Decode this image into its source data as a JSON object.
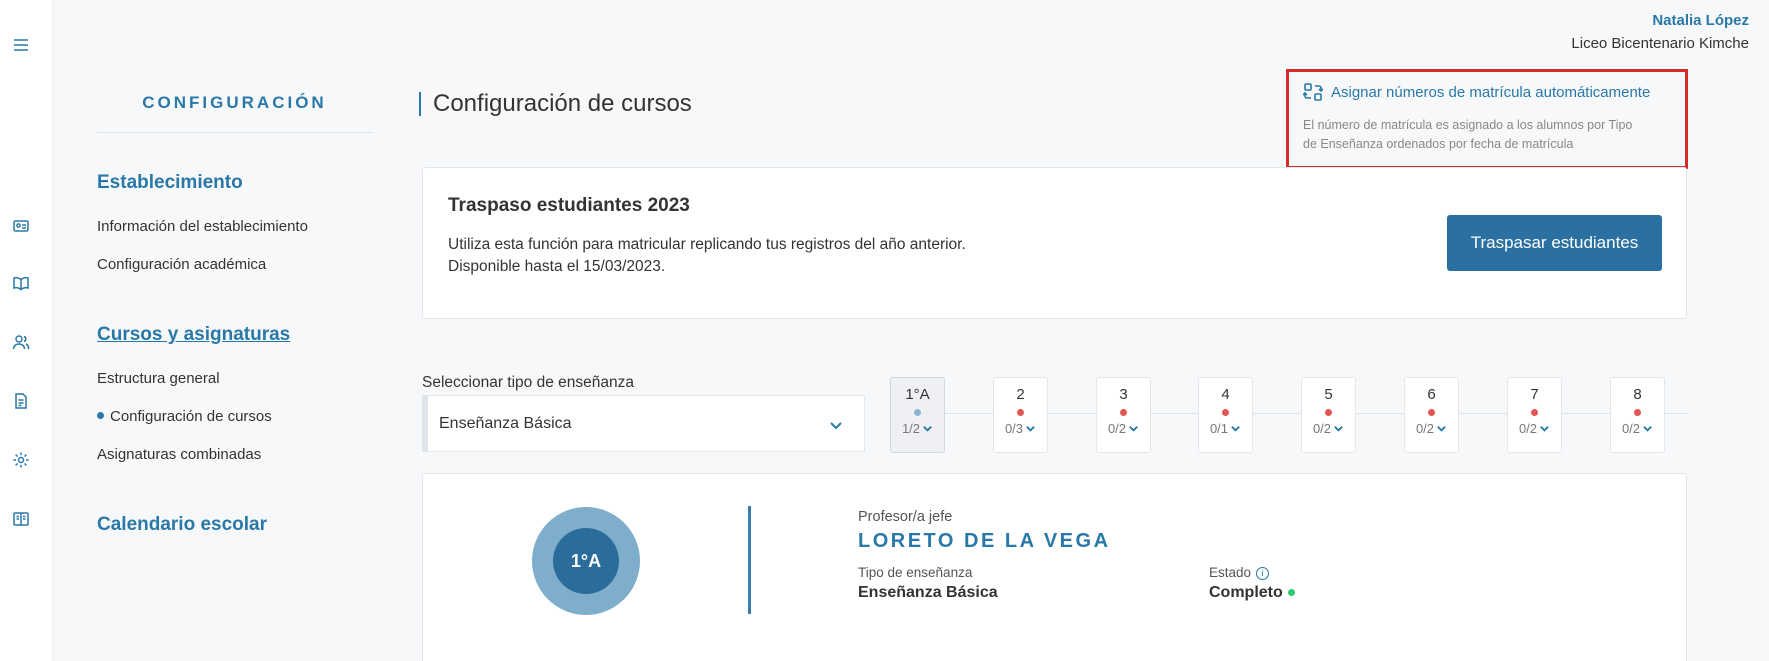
{
  "user": {
    "name": "Natalia López",
    "org": "Liceo Bicentenario Kimche"
  },
  "rail_icons": [
    "menu-icon",
    "id-card-icon",
    "book-icon",
    "users-icon",
    "document-icon",
    "gear-icon",
    "open-book-icon"
  ],
  "sidebar": {
    "title": "CONFIGURACIÓN",
    "sections": [
      {
        "label": "Establecimiento",
        "items": [
          "Información del establecimiento",
          "Configuración académica"
        ]
      },
      {
        "label": "Cursos y asignaturas",
        "items": [
          "Estructura general",
          "Configuración de cursos",
          "Asignaturas combinadas"
        ]
      },
      {
        "label": "Calendario escolar",
        "items": []
      }
    ]
  },
  "main": {
    "title": "Configuración de cursos",
    "auto_assign": {
      "link": "Asignar números de matrícula automáticamente",
      "desc_line1": "El número de matrícula es asignado a los alumnos por Tipo",
      "desc_line2": "de Enseñanza ordenados por fecha de matrícula"
    },
    "transfer": {
      "title": "Traspaso estudiantes 2023",
      "line1": "Utiliza esta función para matricular replicando tus registros del año anterior.",
      "line2": "Disponible hasta el 15/03/2023.",
      "button": "Traspasar estudiantes"
    },
    "select": {
      "label": "Seleccionar tipo de enseñanza",
      "value": "Enseñanza Básica"
    },
    "courses": [
      {
        "name": "1°A",
        "count": "1/2"
      },
      {
        "name": "2",
        "count": "0/3"
      },
      {
        "name": "3",
        "count": "0/2"
      },
      {
        "name": "4",
        "count": "0/1"
      },
      {
        "name": "5",
        "count": "0/2"
      },
      {
        "name": "6",
        "count": "0/2"
      },
      {
        "name": "7",
        "count": "0/2"
      },
      {
        "name": "8",
        "count": "0/2"
      }
    ],
    "detail": {
      "badge": "1°A",
      "teacher_label": "Profesor/a jefe",
      "teacher_name": "LORETO DE LA VEGA",
      "type_label": "Tipo de enseñanza",
      "type_value": "Enseñanza Básica",
      "status_label": "Estado",
      "status_value": "Completo"
    }
  },
  "colors": {
    "accent": "#2a78a8",
    "button": "#2a70a0",
    "highlight_border": "#d42b2b",
    "pending_dot": "#e25555",
    "complete_dot": "#2ecc71"
  }
}
